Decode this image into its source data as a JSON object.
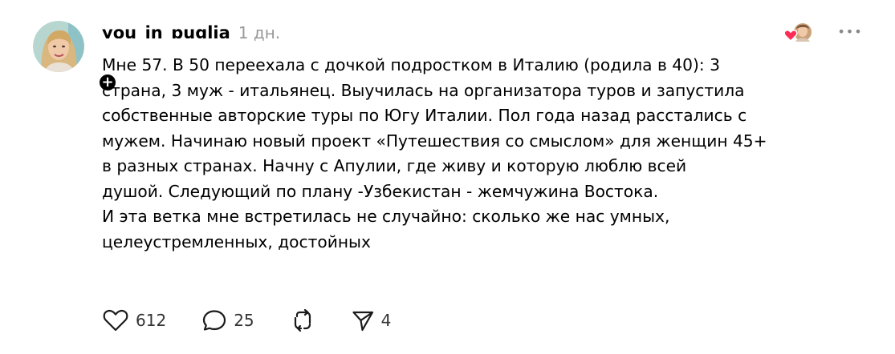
{
  "post": {
    "username": "you_in_puglia",
    "time": "1 дн.",
    "body_lines": [
      "Мне 57. В 50 переехала с дочкой подростком в Италию (родила в 40): 3",
      "страна, 3 муж - итальянец. Выучилась на организатора туров и запустила",
      "собственные авторские туры по Югу Италии. Пол года назад расстались с",
      "мужем. Начинаю новый проект «Путешествия со смыслом» для женщин 45+",
      "в разных странах. Начну с Апулии, где живу и которую люблю всей",
      "душой. Следующий по плану -Узбекистан - жемчужина Востока.",
      "И эта ветка мне встретилась не случайно: сколько же нас умных,",
      "целеустремленных, достойных"
    ],
    "follow_symbol": "+",
    "more_symbol": "•••"
  },
  "actions": {
    "likes": "612",
    "comments": "25",
    "shares": "4"
  },
  "icons": {
    "like": "heart-icon",
    "comment": "comment-icon",
    "repost": "repost-icon",
    "share": "send-icon",
    "more": "more-icon",
    "follow": "plus-icon"
  },
  "colors": {
    "text": "#000000",
    "muted": "#999999",
    "heart_red": "#ff2d55",
    "badge": "#000000"
  }
}
